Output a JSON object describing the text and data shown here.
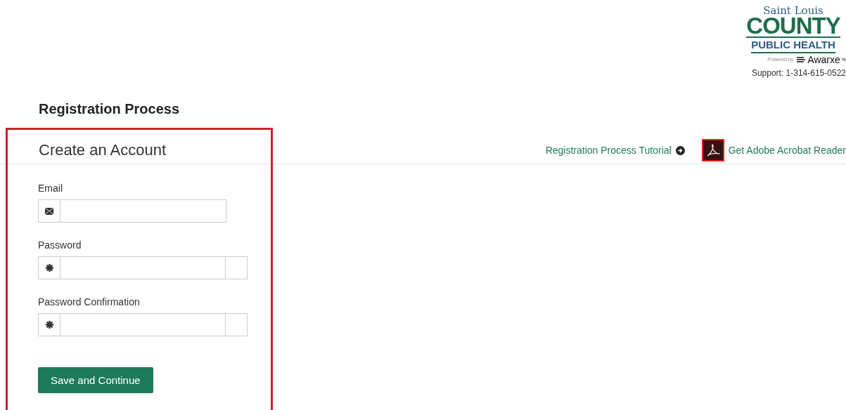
{
  "logo": {
    "line_1": "Saint Louis",
    "line_2": "COUNTY",
    "line_3": "PUBLIC HEALTH",
    "powered_by": "Powered by",
    "brand": "Awarxe",
    "brand_mark": "TM"
  },
  "support": "Support: 1-314-615-0522",
  "page_title": "Registration Process",
  "form": {
    "title": "Create an Account",
    "fields": [
      {
        "kind": "email",
        "label": "Email"
      },
      {
        "kind": "password",
        "label": "Password"
      },
      {
        "kind": "password",
        "label": "Password Confirmation"
      }
    ],
    "submit": "Save and Continue"
  },
  "links": [
    {
      "kind": "tutorial",
      "label": "Registration Process Tutorial"
    },
    {
      "kind": "acrobat",
      "label": "Get Adobe Acrobat Reader"
    }
  ]
}
